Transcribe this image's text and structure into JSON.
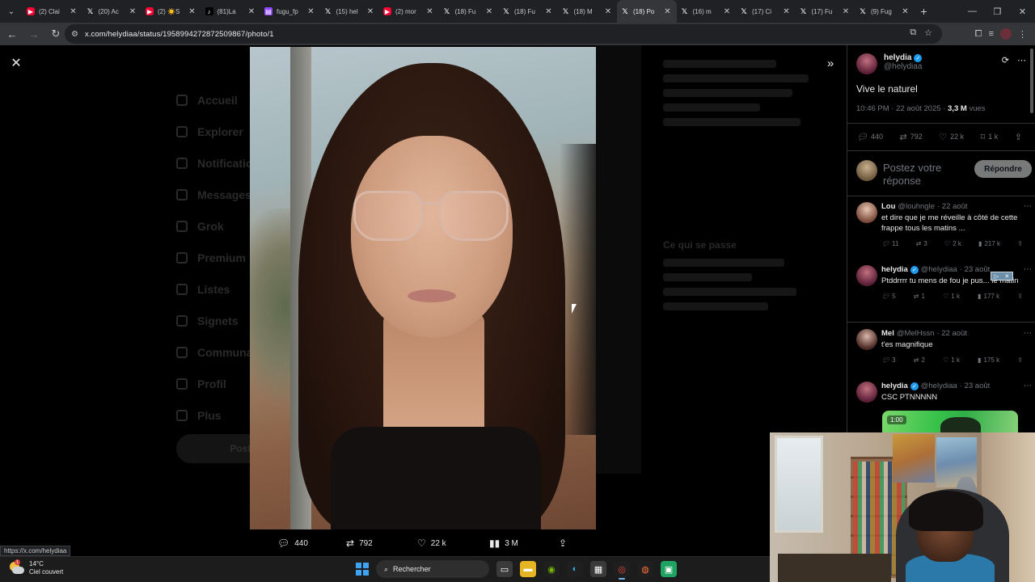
{
  "browser": {
    "tabs": [
      {
        "title": "(2) Clai",
        "icon": "youtube",
        "active": false
      },
      {
        "title": "(20) Ac",
        "icon": "x",
        "active": false
      },
      {
        "title": "(2) ☀️S",
        "icon": "youtube",
        "active": false
      },
      {
        "title": "(81)La",
        "icon": "tiktok",
        "active": false
      },
      {
        "title": "fugu_fp",
        "icon": "twitch",
        "active": false
      },
      {
        "title": "(15) hel",
        "icon": "x",
        "active": false
      },
      {
        "title": "(2) mor",
        "icon": "youtube",
        "active": false
      },
      {
        "title": "(18) Fu",
        "icon": "x",
        "active": false
      },
      {
        "title": "(18) Fu",
        "icon": "x",
        "active": false
      },
      {
        "title": "(18) M",
        "icon": "x",
        "active": false
      },
      {
        "title": "(18) Po",
        "icon": "x",
        "active": true
      },
      {
        "title": "(16) m",
        "icon": "x",
        "active": false
      },
      {
        "title": "(17) Ci",
        "icon": "x",
        "active": false
      },
      {
        "title": "(17) Fu",
        "icon": "x",
        "active": false
      },
      {
        "title": "(9) Fug",
        "icon": "x",
        "active": false
      }
    ],
    "url": "x.com/helydiaa/status/1958994272872509867/photo/1",
    "status_url": "https://x.com/helydiaa"
  },
  "background_nav": [
    "Accueil",
    "Explorer",
    "Notifications",
    "Messages",
    "Grok",
    "Premium",
    "Listes",
    "Signets",
    "Communautés",
    "Profil",
    "Plus"
  ],
  "background_post_button": "Poster",
  "background_trends_heading": "Ce qui se passe",
  "photo_actions": {
    "replies": "440",
    "reposts": "792",
    "likes": "22 k",
    "views": "3 M"
  },
  "tweet": {
    "author_name": "helydia",
    "author_handle": "@helydiaa",
    "text": "Vive le naturel",
    "timestamp": "10:46 PM · 22 août 2025 ·",
    "views_count": "3,3 M",
    "views_label": "vues",
    "stats": {
      "replies": "440",
      "reposts": "792",
      "likes": "22 k",
      "bookmarks": "1 k"
    },
    "reply_placeholder": "Postez votre réponse",
    "reply_button": "Répondre"
  },
  "replies": [
    {
      "name": "Lou",
      "handle": "@louhngle",
      "date": "· 22 août",
      "verified": false,
      "text": "et dire que je me réveille à côté de cette frappe tous les matins  ...",
      "stats": {
        "replies": "11",
        "reposts": "3",
        "likes": "2 k",
        "views": "217 k"
      }
    },
    {
      "name": "helydia",
      "handle": "@helydiaa",
      "date": "· 23 août",
      "verified": true,
      "text": "Ptddrrrr tu mens de fou je pus... le matin",
      "stats": {
        "replies": "5",
        "reposts": "1",
        "likes": "1 k",
        "views": "177 k"
      }
    },
    {
      "name": "Mel",
      "handle": "@MelHssn",
      "date": "· 22 août",
      "verified": false,
      "text": "t'es magnifique",
      "stats": {
        "replies": "3",
        "reposts": "2",
        "likes": "1 k",
        "views": "175 k"
      }
    },
    {
      "name": "helydia",
      "handle": "@helydiaa",
      "date": "· 23 août",
      "verified": true,
      "text": "CSC PTNNNNN",
      "gif_duration": "1:00"
    }
  ],
  "taskbar": {
    "temperature": "14°C",
    "weather": "Ciel couvert",
    "search_label": "Rechercher"
  },
  "colors": {
    "accent_blue": "#1d9bf0",
    "reply_button_bg": "#787a7a",
    "tab_strip": "#202124",
    "toolbar": "#35363a"
  }
}
